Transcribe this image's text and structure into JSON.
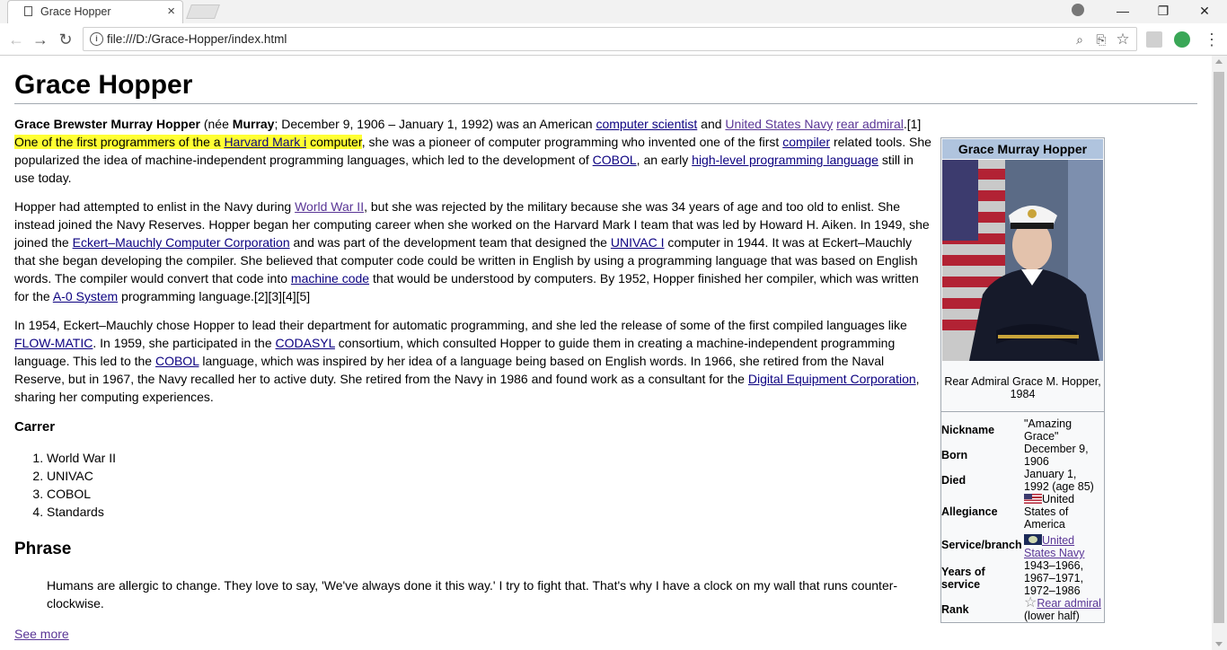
{
  "browser": {
    "tab_title": "Grace Hopper",
    "tab_close": "×",
    "url": "file:///D:/Grace-Hopper/index.html",
    "win_minimize": "—",
    "win_restore": "❐",
    "win_close": "✕",
    "back": "←",
    "forward": "→",
    "reload": "↻",
    "info": "i",
    "zoom_icon": "⌕",
    "translate_icon": "⎘",
    "star_icon": "☆",
    "menu_icon": "⋮"
  },
  "article": {
    "title": "Grace Hopper",
    "p1": {
      "bold_name": "Grace Brewster Murray Hopper",
      "nee_open": " (née ",
      "murray": "Murray",
      "t1": "; December 9, 1906 – January 1, 1992) was an American ",
      "link_cs": "computer scientist",
      "t2": " and ",
      "link_navy": "United States Navy",
      "t3": " ",
      "link_ra": "rear admiral",
      "t4": ".[1] ",
      "hl1": "One of the first programmers of the a ",
      "link_mark": "Harvard Mark i",
      "hl2": " computer",
      "t5": ", she was a pioneer of computer programming who invented one of the first ",
      "link_compiler": "compiler",
      "t6": " related tools. She popularized the idea of machine-independent programming languages, which led to the development of ",
      "link_cobol": "COBOL",
      "t7": ", an early ",
      "link_hll": "high-level programming language",
      "t8": " still in use today."
    },
    "p2": {
      "t1": "Hopper had attempted to enlist in the Navy during ",
      "link_ww2": "World War II",
      "t2": ", but she was rejected by the military because she was 34 years of age and too old to enlist. She instead joined the Navy Reserves. Hopper began her computing career when she worked on the Harvard Mark I team that was led by Howard H. Aiken. In 1949, she joined the ",
      "link_emcc": "Eckert–Mauchly Computer Corporation",
      "t3": " and was part of the development team that designed the ",
      "link_univac": "UNIVAC I",
      "t4": " computer in 1944. It was at Eckert–Mauchly that she began developing the compiler. She believed that computer code could be written in English by using a programming language that was based on English words. The compiler would convert that code into ",
      "link_mc": "machine code",
      "t5": " that would be understood by computers. By 1952, Hopper finished her compiler, which was written for the ",
      "link_a0": "A-0 System",
      "t6": " programming language.[2][3][4][5]"
    },
    "p3": {
      "t1": "In 1954, Eckert–Mauchly chose Hopper to lead their department for automatic programming, and she led the release of some of the first compiled languages like ",
      "link_flow": "FLOW-MATIC",
      "t2": ". In 1959, she participated in the ",
      "link_codasyl": "CODASYL",
      "t3": " consortium, which consulted Hopper to guide them in creating a machine-independent programming language. This led to the ",
      "link_cobol": "COBOL",
      "t4": " language, which was inspired by her idea of a language being based on English words. In 1966, she retired from the Naval Reserve, but in 1967, the Navy recalled her to active duty. She retired from the Navy in 1986 and found work as a consultant for the ",
      "link_dec": "Digital Equipment Corporation",
      "t5": ", sharing her computing experiences."
    },
    "career_heading": "Carrer",
    "career_items": [
      "World War II",
      "UNIVAC",
      "COBOL",
      "Standards"
    ],
    "phrase_heading": "Phrase",
    "quote": "Humans are allergic to change. They love to say, 'We've always done it this way.' I try to fight that. That's why I have a clock on my wall that runs counter-clockwise.",
    "see_more": "See more"
  },
  "infobox": {
    "title": "Grace Murray Hopper",
    "caption": "Rear Admiral Grace M. Hopper, 1984",
    "rows": {
      "nickname_k": "Nickname",
      "nickname_v": "\"Amazing Grace\"",
      "born_k": "Born",
      "born_v": "December 9, 1906",
      "died_k": "Died",
      "died_v": "January 1, 1992 (age 85)",
      "allegiance_k": "Allegiance",
      "allegiance_v": "United States of America",
      "service_k": "Service/branch",
      "service_link": "United States Navy",
      "years_k": "Years of service",
      "years_v": "1943–1966, 1967–1971, 1972–1986",
      "rank_k": "Rank",
      "rank_star": "☆",
      "rank_link": "Rear admiral",
      "rank_suffix": " (lower half)"
    }
  }
}
